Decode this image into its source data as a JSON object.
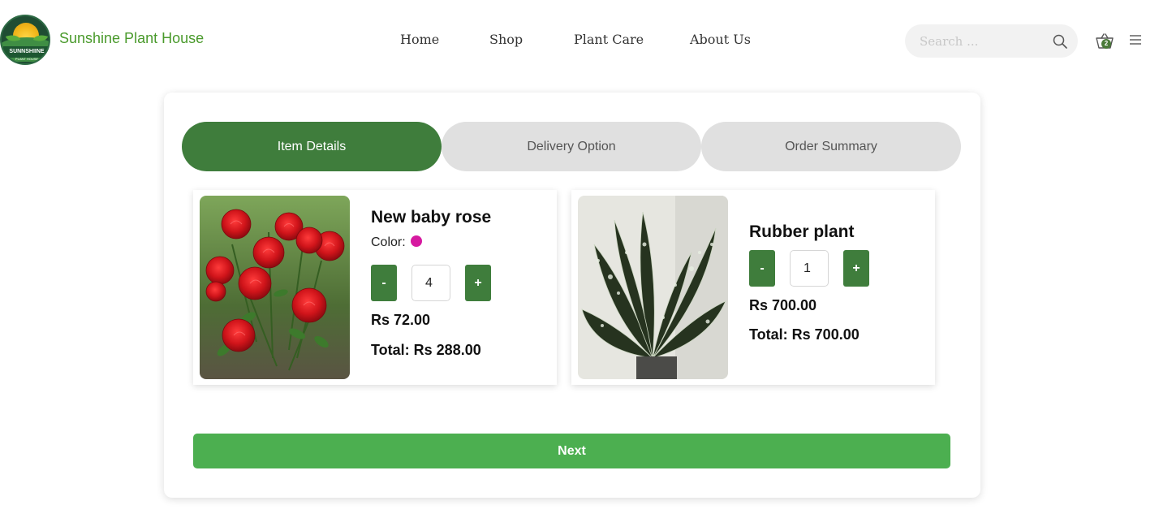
{
  "brand": {
    "name": "Sunshine Plant House",
    "logo_text": "SUNNSHIINE",
    "logo_subtext": "PLANT HOUSE"
  },
  "nav": {
    "items": [
      "Home",
      "Shop",
      "Plant Care",
      "About Us"
    ]
  },
  "search": {
    "placeholder": "Search ..."
  },
  "cart": {
    "count": "2"
  },
  "steps": [
    {
      "label": "Item Details",
      "active": true
    },
    {
      "label": "Delivery Option",
      "active": false
    },
    {
      "label": "Order Summary",
      "active": false
    }
  ],
  "items": [
    {
      "name": "New baby rose",
      "color_label": "Color:",
      "color": "#d61aa0",
      "quantity": "4",
      "price": "Rs 72.00",
      "total": "Total: Rs 288.00",
      "minus_label": "-",
      "plus_label": "+"
    },
    {
      "name": "Rubber plant",
      "quantity": "1",
      "price": "Rs 700.00",
      "total": "Total: Rs 700.00",
      "minus_label": "-",
      "plus_label": "+"
    }
  ],
  "next_label": "Next",
  "colors": {
    "accent": "#3f7d3c",
    "next_button": "#4caf50",
    "brand_text": "#4a9a2c"
  }
}
